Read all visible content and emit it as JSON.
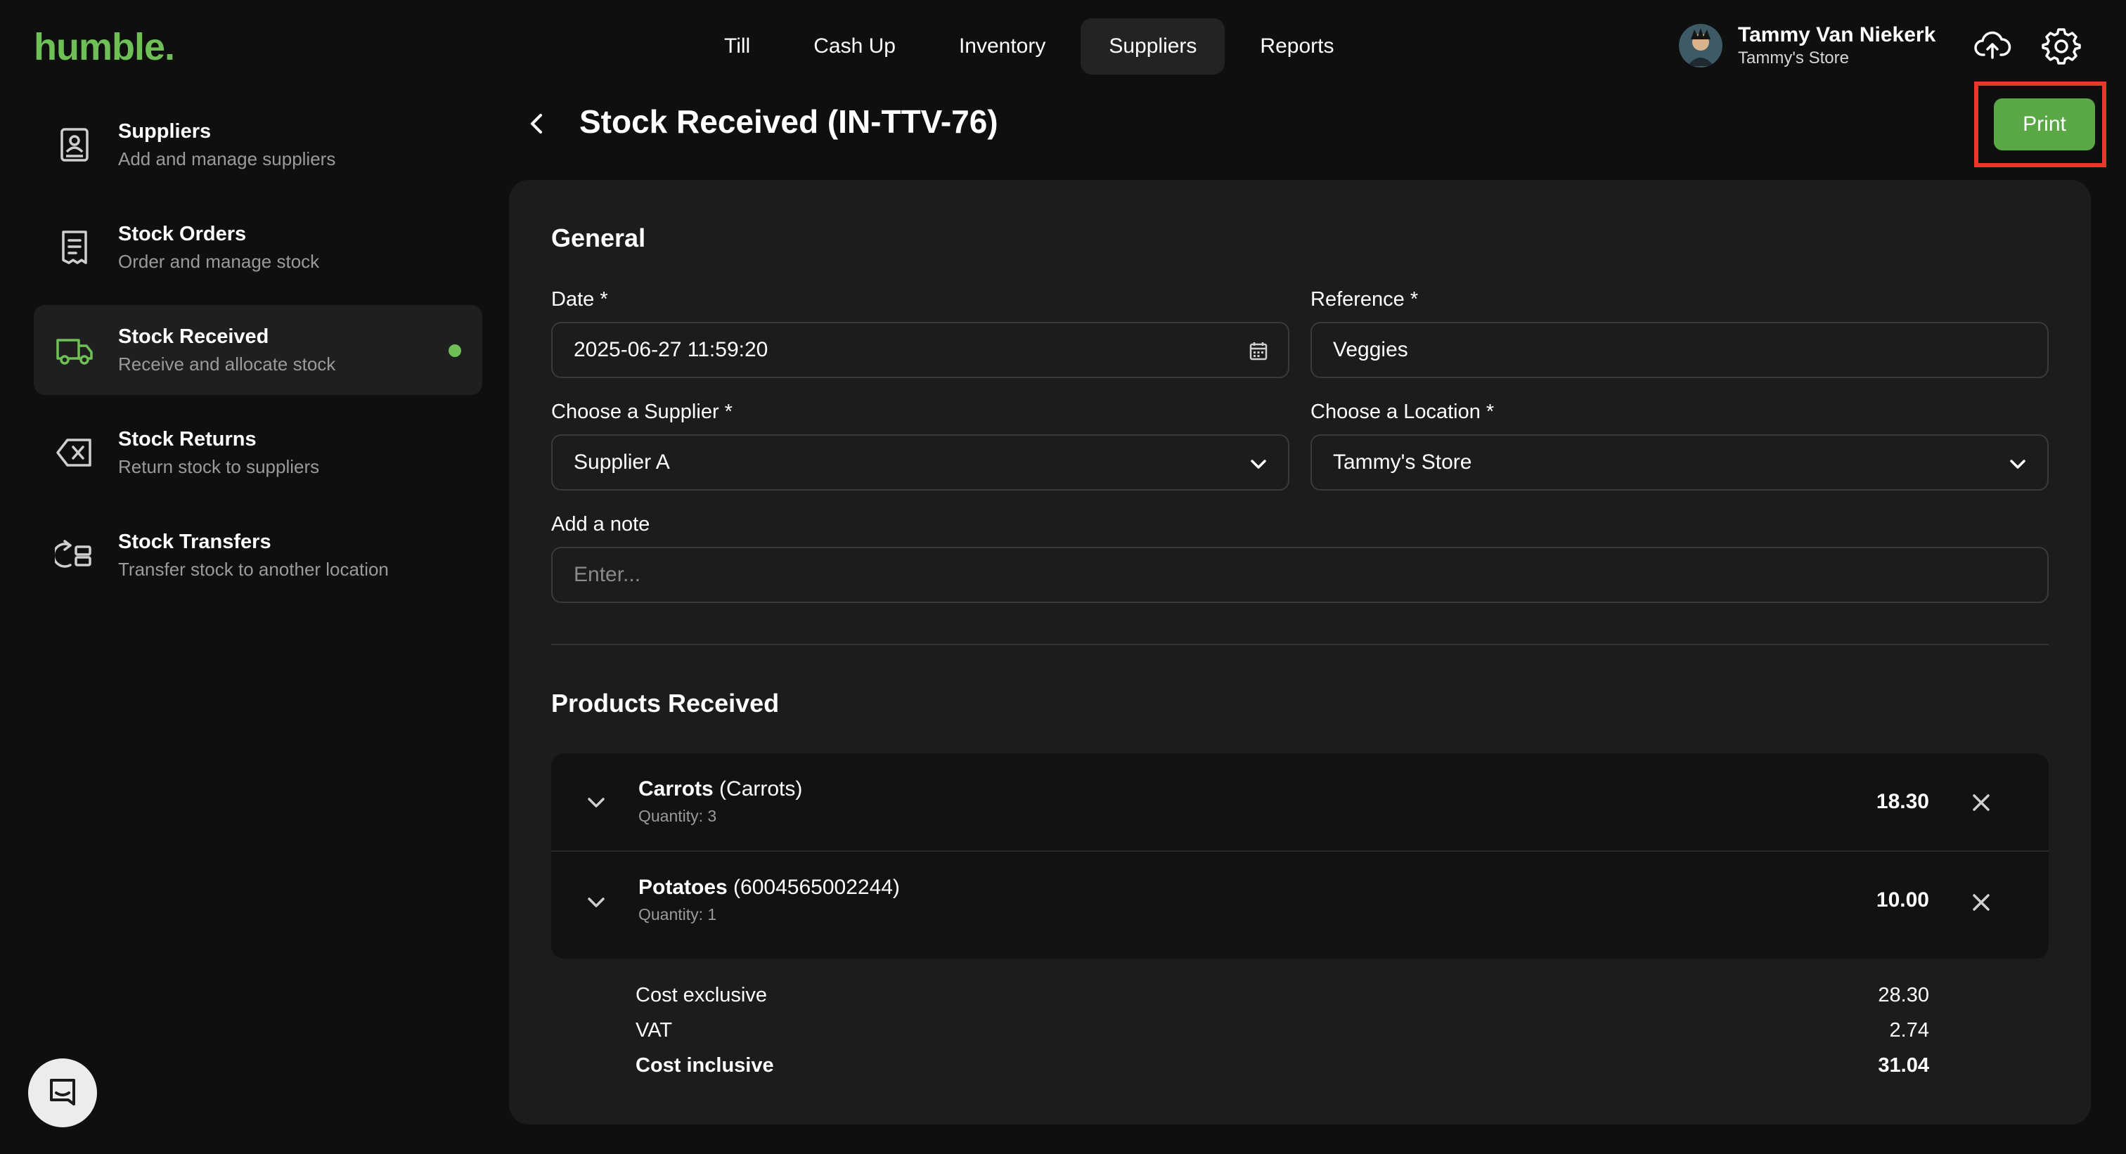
{
  "app": {
    "logo": "humble."
  },
  "nav": {
    "items": [
      {
        "label": "Till",
        "active": false
      },
      {
        "label": "Cash Up",
        "active": false
      },
      {
        "label": "Inventory",
        "active": false
      },
      {
        "label": "Suppliers",
        "active": true
      },
      {
        "label": "Reports",
        "active": false
      }
    ]
  },
  "user": {
    "name": "Tammy Van Niekerk",
    "store": "Tammy's Store"
  },
  "header_icons": [
    "cloud-upload-icon",
    "gear-icon"
  ],
  "sidebar": {
    "items": [
      {
        "title": "Suppliers",
        "subtitle": "Add and manage suppliers",
        "icon": "supplier-badge-icon",
        "active": false
      },
      {
        "title": "Stock Orders",
        "subtitle": "Order and manage stock",
        "icon": "receipt-icon",
        "active": false
      },
      {
        "title": "Stock Received",
        "subtitle": "Receive and allocate stock",
        "icon": "truck-icon",
        "active": true
      },
      {
        "title": "Stock Returns",
        "subtitle": "Return stock to suppliers",
        "icon": "backspace-icon",
        "active": false
      },
      {
        "title": "Stock Transfers",
        "subtitle": "Transfer stock to another location",
        "icon": "transfer-icon",
        "active": false
      }
    ]
  },
  "page": {
    "title": "Stock Received (IN-TTV-76)",
    "print_label": "Print"
  },
  "general": {
    "title": "General",
    "date_label": "Date *",
    "date_value": "2025-06-27 11:59:20",
    "reference_label": "Reference *",
    "reference_value": "Veggies",
    "supplier_label": "Choose a Supplier *",
    "supplier_value": "Supplier A",
    "location_label": "Choose a Location *",
    "location_value": "Tammy's Store",
    "note_label": "Add a note",
    "note_placeholder": "Enter..."
  },
  "products": {
    "title": "Products Received",
    "items": [
      {
        "name": "Carrots",
        "code": "(Carrots)",
        "quantity": "Quantity: 3",
        "total": "18.30"
      },
      {
        "name": "Potatoes",
        "code": "(6004565002244)",
        "quantity": "Quantity: 1",
        "total": "10.00"
      }
    ]
  },
  "summary": {
    "cost_exclusive_label": "Cost exclusive",
    "cost_exclusive_value": "28.30",
    "vat_label": "VAT",
    "vat_value": "2.74",
    "cost_inclusive_label": "Cost inclusive",
    "cost_inclusive_value": "31.04"
  },
  "colors": {
    "accent": "#6ebf55",
    "button": "#5aa845",
    "highlight": "#e53a2a",
    "card": "#1c1c1c",
    "background": "#0f0f0f"
  }
}
